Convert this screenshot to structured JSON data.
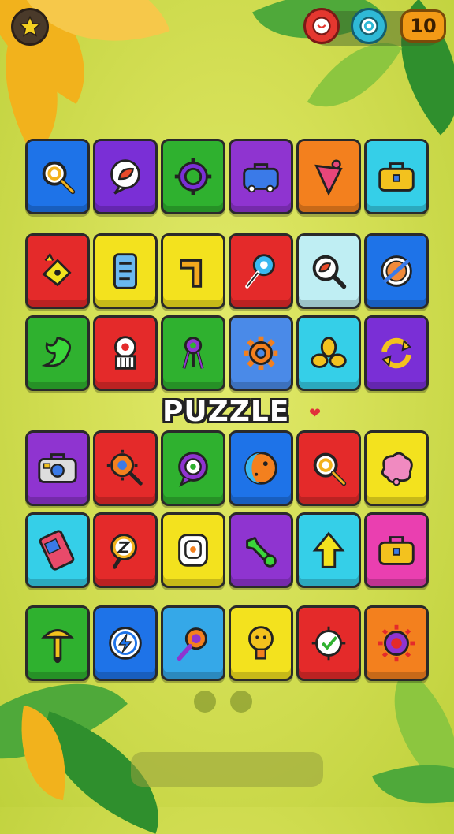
{
  "header": {
    "star_icon": "star-icon",
    "red_icon": "clock-badge-icon",
    "teal_icon": "compass-badge-icon",
    "count": "10",
    "colors": {
      "star": "#f5d020",
      "red": "#e4372f",
      "teal": "#2fb9d6",
      "count": "#f39a16"
    }
  },
  "banner": {
    "text": "PUZZLE",
    "heart_icon": "heart-icon"
  },
  "tiles": [
    {
      "bg": "#1e73e8",
      "icon": "magnifier-icon"
    },
    {
      "bg": "#7a2fd6",
      "icon": "chat-leaf-icon"
    },
    {
      "bg": "#2fb12f",
      "icon": "gear-ring-icon"
    },
    {
      "bg": "#8f34d0",
      "icon": "toolbox-icon"
    },
    {
      "bg": "#f3801e",
      "icon": "bell-cone-icon"
    },
    {
      "bg": "#35cfe8",
      "icon": "suitcase-icon"
    },
    {
      "bg": "#e42a2a",
      "icon": "rocket-tag-icon"
    },
    {
      "bg": "#f3e21e",
      "icon": "document-icon"
    },
    {
      "bg": "#f3e21e",
      "icon": "pipe-icon"
    },
    {
      "bg": "#e42a2a",
      "icon": "lollipop-icon"
    },
    {
      "bg": "#bfeef3",
      "icon": "magnifier-leaf-icon"
    },
    {
      "bg": "#1e73e8",
      "icon": "planet-icon"
    },
    {
      "bg": "#2fb12f",
      "icon": "swirl-leaf-icon"
    },
    {
      "bg": "#e42a2a",
      "icon": "robot-icon"
    },
    {
      "bg": "#2fb12f",
      "icon": "medal-icon"
    },
    {
      "bg": "#4a8ae8",
      "icon": "gear-icon"
    },
    {
      "bg": "#35cfe8",
      "icon": "petals-icon"
    },
    {
      "bg": "#7a2fd6",
      "icon": "refresh-icon"
    },
    {
      "bg": "#8f34d0",
      "icon": "radio-icon"
    },
    {
      "bg": "#e42a2a",
      "icon": "gear-magnifier-icon"
    },
    {
      "bg": "#2fb12f",
      "icon": "target-chat-icon"
    },
    {
      "bg": "#1e73e8",
      "icon": "moon-ball-icon"
    },
    {
      "bg": "#e42a2a",
      "icon": "magnifier-icon"
    },
    {
      "bg": "#f3e21e",
      "icon": "blob-icon"
    },
    {
      "bg": "#35cfe8",
      "icon": "phone-icon"
    },
    {
      "bg": "#e42a2a",
      "icon": "sleep-magnifier-icon"
    },
    {
      "bg": "#f3e21e",
      "icon": "scroll-icon"
    },
    {
      "bg": "#8f34d0",
      "icon": "wrench-icon"
    },
    {
      "bg": "#35cfe8",
      "icon": "arrow-up-icon"
    },
    {
      "bg": "#ea3fb0",
      "icon": "suitcase-icon"
    },
    {
      "bg": "#2fb12f",
      "icon": "hammer-icon"
    },
    {
      "bg": "#1e73e8",
      "icon": "lightning-badge-icon"
    },
    {
      "bg": "#35a8e8",
      "icon": "flower-magnifier-icon"
    },
    {
      "bg": "#f3e21e",
      "icon": "bulb-icon"
    },
    {
      "bg": "#e42a2a",
      "icon": "check-gear-icon"
    },
    {
      "bg": "#f3801e",
      "icon": "sun-gear-icon"
    }
  ],
  "pager": {
    "dots": 2
  }
}
